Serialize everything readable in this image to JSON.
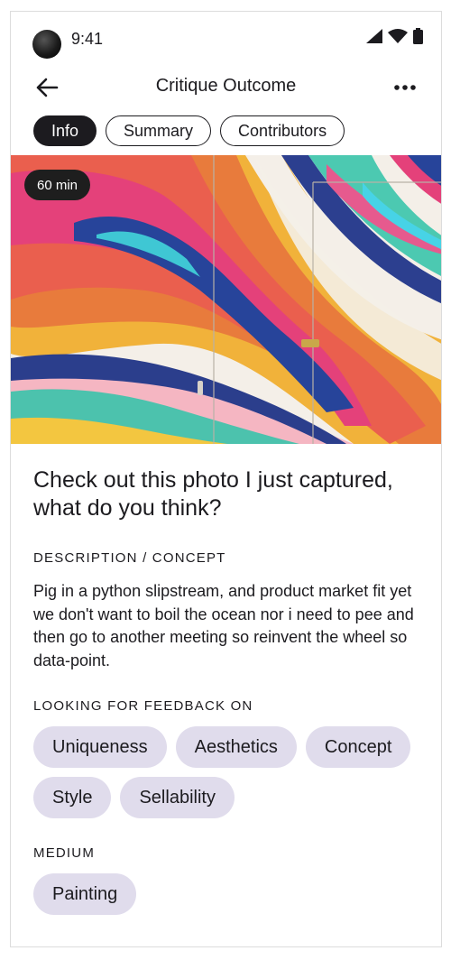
{
  "status_bar": {
    "time": "9:41"
  },
  "app_bar": {
    "title": "Critique Outcome"
  },
  "tabs": [
    {
      "label": "Info",
      "active": true
    },
    {
      "label": "Summary",
      "active": false
    },
    {
      "label": "Contributors",
      "active": false
    }
  ],
  "hero": {
    "duration_badge": "60 min"
  },
  "post": {
    "headline": "Check out this photo I just captured, what do you think?",
    "description_heading": "DESCRIPTION / CONCEPT",
    "description": "Pig in a python slipstream, and product market fit yet we don't want to boil the ocean nor i need to pee and then go to another meeting so reinvent the wheel so data-point.",
    "feedback_heading": "LOOKING FOR FEEDBACK ON",
    "feedback_tags": [
      "Uniqueness",
      "Aesthetics",
      "Concept",
      "Style",
      "Sellability"
    ],
    "medium_heading": "MEDIUM",
    "medium_tags": [
      "Painting"
    ]
  },
  "colors": {
    "chip_bg": "#e0dcec",
    "active_tab_bg": "#1c1b1f",
    "badge_bg": "#1e1e1e"
  },
  "icons": [
    "camera-icon",
    "signal-icon",
    "wifi-icon",
    "battery-icon",
    "back-arrow-icon",
    "more-options-icon"
  ]
}
